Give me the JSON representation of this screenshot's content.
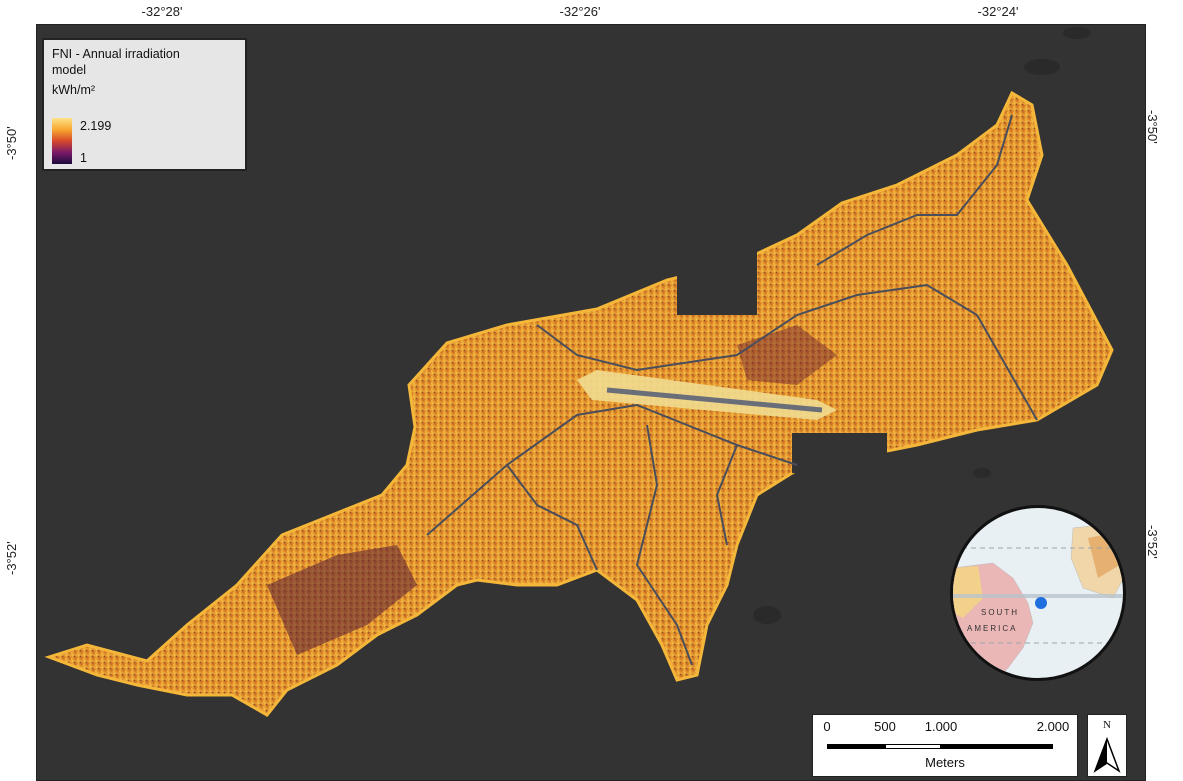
{
  "map": {
    "colors": {
      "ocean": "#333333",
      "land_bright": "#fbd25c",
      "land_mid": "#e08a2a",
      "land_dark": "#3a1830",
      "roads": "#4a4e5a"
    }
  },
  "graticule": {
    "top": [
      "-32°28'",
      "-32°26'",
      "-32°24'"
    ],
    "left": [
      "-3°50'",
      "-3°52'"
    ],
    "right": [
      "-3°50'",
      "-3°52'"
    ]
  },
  "legend": {
    "title": "FNI - Annual irradiation model",
    "unit": "kWh/m²",
    "max_label": "2.199",
    "min_label": "1",
    "max_value": 2.199,
    "min_value": 1
  },
  "scalebar": {
    "labels": [
      "0",
      "500",
      "1.000",
      "2.000"
    ],
    "units": "Meters"
  },
  "north_arrow": {
    "letter": "N",
    "icon": "north-arrow-icon"
  },
  "inset": {
    "label_line1": "SOUTH",
    "label_line2": "AMERICA",
    "marker_color": "#1f6fe0"
  }
}
